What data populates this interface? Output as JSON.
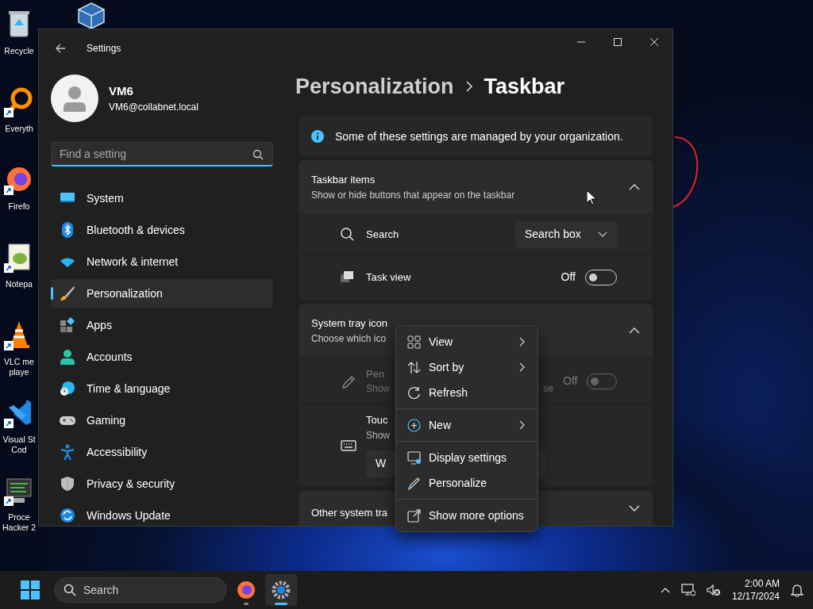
{
  "desktop": {
    "icons": [
      {
        "lines": [
          "Recycle"
        ],
        "shortcut": false
      },
      {
        "lines": [
          "Everyth"
        ],
        "shortcut": true
      },
      {
        "lines": [
          "Firefo"
        ],
        "shortcut": true
      },
      {
        "lines": [
          "Notepa"
        ],
        "shortcut": true
      },
      {
        "lines": [
          "VLC me",
          "playe"
        ],
        "shortcut": true
      },
      {
        "lines": [
          "Visual St",
          "Cod"
        ],
        "shortcut": true
      },
      {
        "lines": [
          "Proce",
          "Hacker 2"
        ],
        "shortcut": true
      }
    ]
  },
  "window": {
    "title": "Settings"
  },
  "account": {
    "name": "VM6",
    "email": "VM6@collabnet.local"
  },
  "search": {
    "placeholder": "Find a setting"
  },
  "nav": [
    {
      "label": "System",
      "selected": false
    },
    {
      "label": "Bluetooth & devices",
      "selected": false
    },
    {
      "label": "Network & internet",
      "selected": false
    },
    {
      "label": "Personalization",
      "selected": true
    },
    {
      "label": "Apps",
      "selected": false
    },
    {
      "label": "Accounts",
      "selected": false
    },
    {
      "label": "Time & language",
      "selected": false
    },
    {
      "label": "Gaming",
      "selected": false
    },
    {
      "label": "Accessibility",
      "selected": false
    },
    {
      "label": "Privacy & security",
      "selected": false
    },
    {
      "label": "Windows Update",
      "selected": false
    }
  ],
  "breadcrumb": [
    "Personalization",
    "Taskbar"
  ],
  "notice": "Some of these settings are managed by your organization.",
  "sections": [
    {
      "title": "Taskbar items",
      "subtitle": "Show or hide buttons that appear on the taskbar",
      "expanded": true,
      "rows": [
        {
          "kind": "dropdown",
          "label": "Search",
          "value": "Search box",
          "disabled": false
        },
        {
          "kind": "toggle",
          "label": "Task view",
          "state_label": "Off",
          "on": false,
          "disabled": false
        }
      ]
    },
    {
      "title": "System tray icon",
      "subtitle": "Choose which ico",
      "expanded": true,
      "rows": [
        {
          "kind": "toggle",
          "label": "Pen",
          "description": "Show",
          "description_tail": "se",
          "state_label": "Off",
          "on": false,
          "disabled": true
        },
        {
          "kind": "dropdown_below",
          "label": "Touc",
          "description": "Show",
          "value": "W",
          "disabled": false
        }
      ]
    },
    {
      "title": "Other system tra",
      "expanded": false
    }
  ],
  "context_menu": [
    [
      {
        "label": "View",
        "submenu": true
      },
      {
        "label": "Sort by",
        "submenu": true
      },
      {
        "label": "Refresh",
        "submenu": false
      }
    ],
    [
      {
        "label": "New",
        "submenu": true
      }
    ],
    [
      {
        "label": "Display settings",
        "submenu": false
      },
      {
        "label": "Personalize",
        "submenu": false
      }
    ],
    [
      {
        "label": "Show more options",
        "submenu": false
      }
    ]
  ],
  "taskbar": {
    "search_placeholder": "Search",
    "apps": [
      {
        "kind": "browser",
        "active": false
      },
      {
        "kind": "settings",
        "active": true
      }
    ],
    "time": "2:00 AM",
    "date": "12/17/2024"
  }
}
